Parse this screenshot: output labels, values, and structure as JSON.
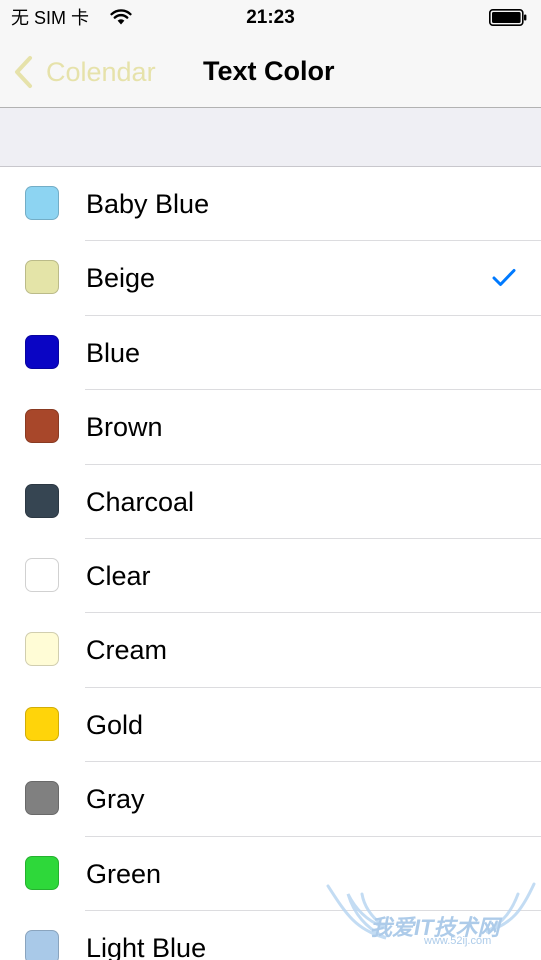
{
  "status_bar": {
    "carrier": "无 SIM 卡",
    "time": "21:23",
    "icons": [
      "wifi-icon",
      "battery-icon"
    ]
  },
  "nav_bar": {
    "back_label": "Colendar",
    "back_icon": "chevron-left-icon",
    "title": "Text Color"
  },
  "colors": {
    "accent": "#007aff",
    "back_tint": "#e6e2aa"
  },
  "selected_index": 1,
  "options": [
    {
      "label": "Baby Blue",
      "color": "#8dd4f2"
    },
    {
      "label": "Beige",
      "color": "#e4e4a8"
    },
    {
      "label": "Blue",
      "color": "#0a05c4"
    },
    {
      "label": "Brown",
      "color": "#a8472a"
    },
    {
      "label": "Charcoal",
      "color": "#364552"
    },
    {
      "label": "Clear",
      "color": "#ffffff"
    },
    {
      "label": "Cream",
      "color": "#fffcd6"
    },
    {
      "label": "Gold",
      "color": "#ffd40a"
    },
    {
      "label": "Gray",
      "color": "#808080"
    },
    {
      "label": "Green",
      "color": "#2ed83a"
    },
    {
      "label": "Light Blue",
      "color": "#a9c9e8"
    }
  ],
  "watermark": {
    "text": "我爱IT技术网",
    "url": "www.52ij.com"
  }
}
